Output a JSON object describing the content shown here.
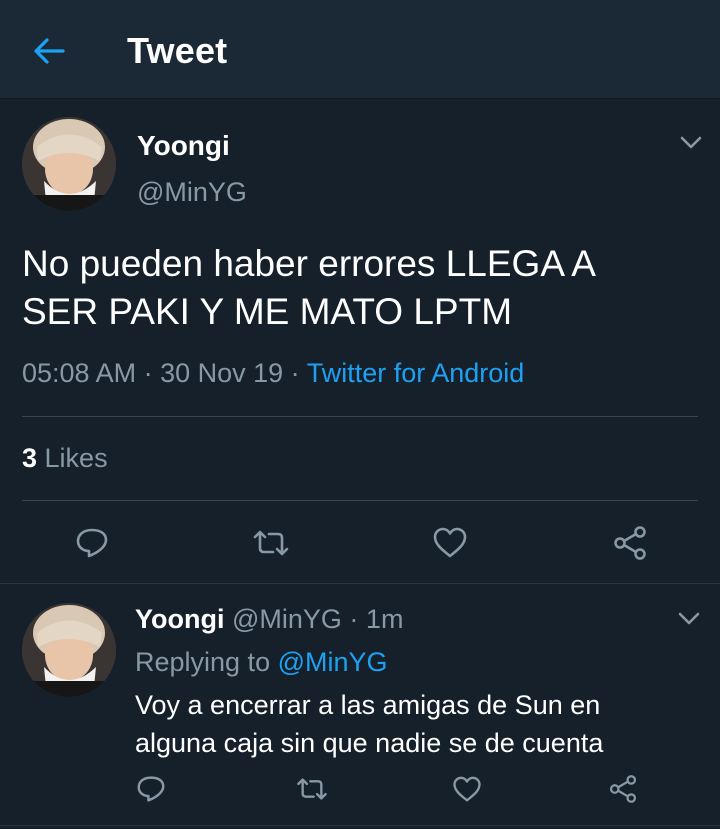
{
  "header": {
    "title": "Tweet",
    "back_icon": "arrow-left-icon"
  },
  "main_tweet": {
    "author_name": "Yoongi",
    "author_handle": "@MinYG",
    "text_line1": "No pueden haber errores LLEGA A",
    "text_line2": "SER PAKI Y ME MATO LPTM",
    "time": "05:08 AM",
    "sep1": " · ",
    "date": "30 Nov 19",
    "sep2": " · ",
    "source": "Twitter for Android",
    "likes_count": "3",
    "likes_label": " Likes"
  },
  "reply_tweet": {
    "author_name": "Yoongi",
    "author_handle": " @MinYG",
    "sep": " · ",
    "age": "1m",
    "replying_label": "Replying to ",
    "replying_handle": "@MinYG",
    "text_line1": "Voy a encerrar a las amigas de Sun en",
    "text_line2": "alguna caja sin que nadie se de cuenta"
  },
  "colors": {
    "background": "#15202b",
    "header": "#1b2836",
    "accent": "#1da1f2",
    "muted": "#8899a6",
    "divider": "#38444d"
  },
  "icons": [
    "arrow-left-icon",
    "chevron-down-icon",
    "reply-icon",
    "retweet-icon",
    "like-icon",
    "share-icon"
  ]
}
